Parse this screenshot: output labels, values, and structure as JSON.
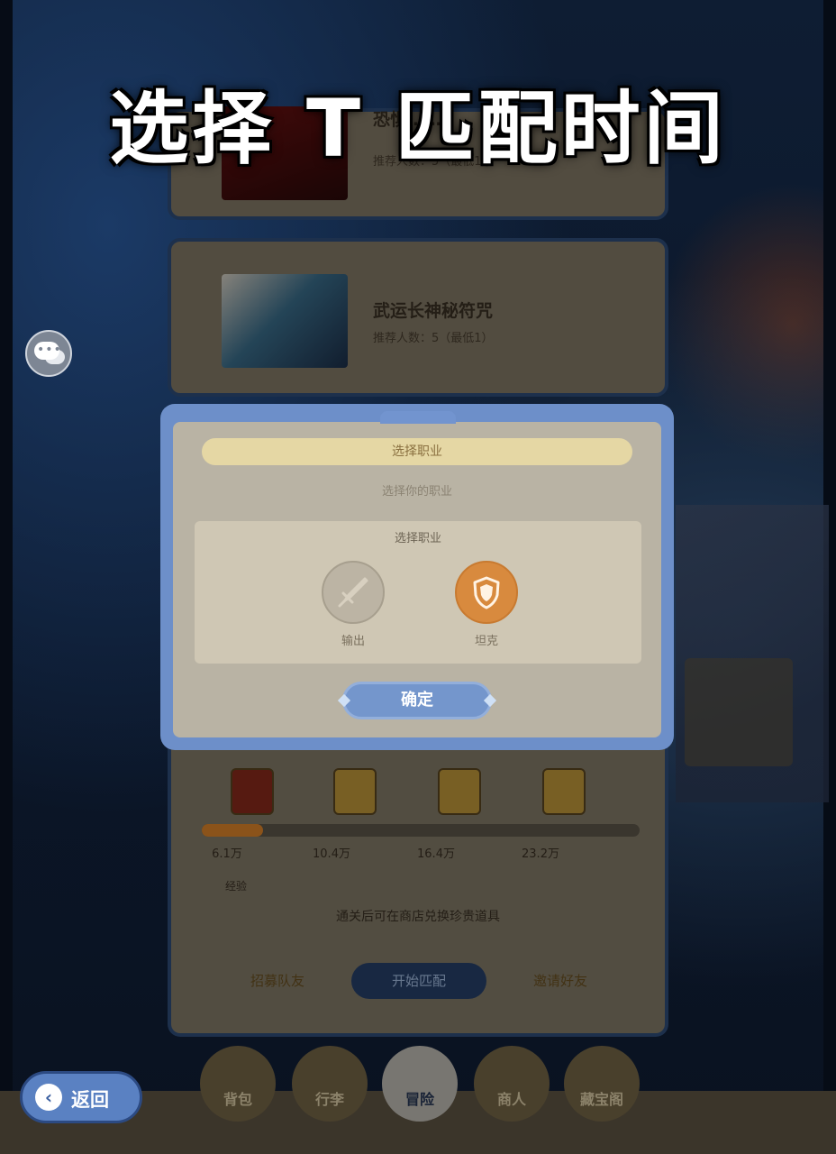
{
  "caption": {
    "text": "选择 T 匹配时间"
  },
  "cards": [
    {
      "title": "恐惧……",
      "subtitle": "推荐人数：5（最低1）"
    },
    {
      "title": "武运长神秘符咒",
      "subtitle": "推荐人数：5（最低1）"
    }
  ],
  "role_dialog": {
    "header": "选择职业",
    "subtitle": "选择你的职业",
    "panel_title": "选择职业",
    "roles": [
      {
        "label": "输出",
        "icon": "sword-icon",
        "selected": false
      },
      {
        "label": "坦克",
        "icon": "shield-icon",
        "selected": true
      }
    ],
    "confirm_label": "确定"
  },
  "progress": {
    "value_percent": 14,
    "ticks": [
      "6.1万",
      "10.4万",
      "16.4万",
      "23.2万"
    ],
    "stat": "经验",
    "notice": "通关后可在商店兑换珍贵道具"
  },
  "actions": {
    "left": "招募队友",
    "primary": "开始匹配",
    "right": "邀请好友"
  },
  "bottom_nav": [
    "背包",
    "行李",
    "冒险",
    "商人",
    "藏宝阁"
  ],
  "back_button": {
    "label": "返回"
  },
  "colors": {
    "modal_frame": "#6d8fc9",
    "tank_selected": "#d88a3e",
    "confirm_button": "#7496cc",
    "progress_fill": "#e0862a"
  }
}
